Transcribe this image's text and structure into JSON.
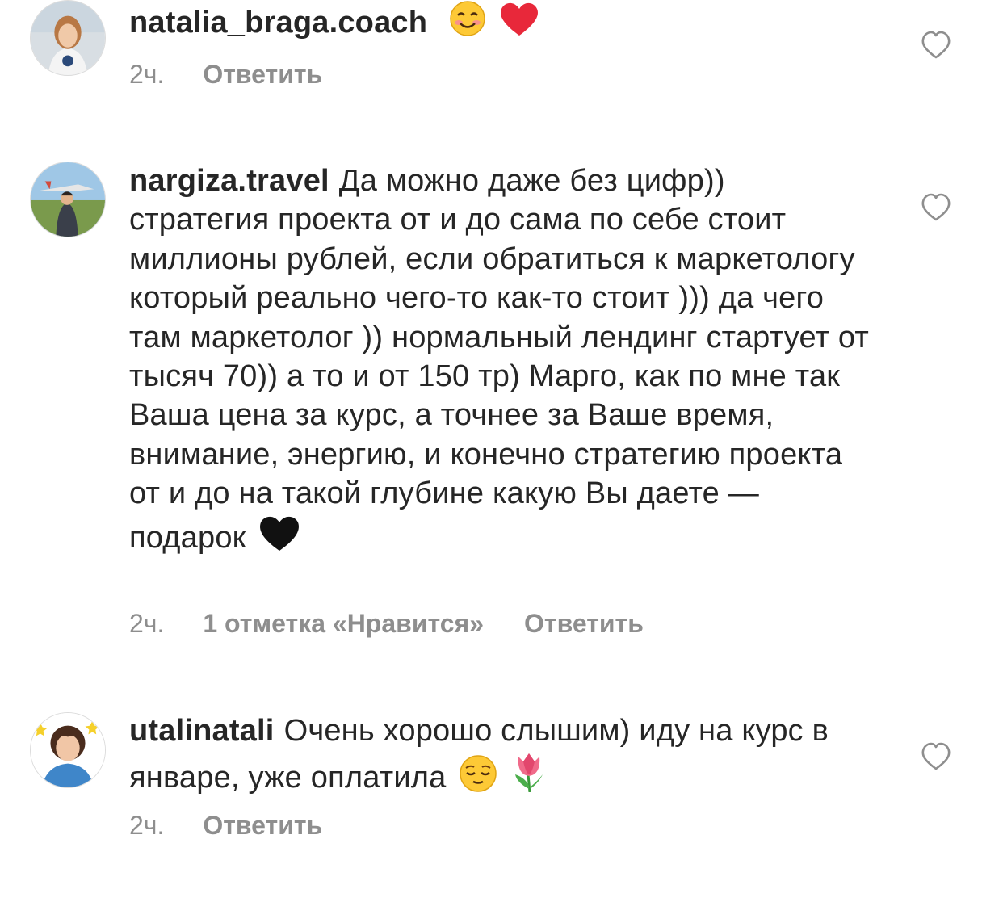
{
  "comments": [
    {
      "username": "natalia_braga.coach",
      "text": "",
      "emojis": [
        "smiling-face-emoji",
        "red-heart-emoji"
      ],
      "time": "2ч.",
      "likes": "",
      "reply_label": "Ответить"
    },
    {
      "username": "nargiza.travel",
      "text": "Да можно даже без цифр)) стратегия проекта от и до сама по себе стоит миллионы рублей, если обратиться к маркетологу который реально чего-то как-то стоит ))) да чего там маркетолог )) нормальный лендинг стартует от тысяч 70)) а то и от 150 тр) Марго,  как по мне так Ваша цена за курс, а точнее за Ваше время, внимание, энергию, и конечно стратегию проекта от и до на такой глубине какую Вы даете — подарок",
      "emojis": [
        "black-heart-emoji"
      ],
      "time": "2ч.",
      "likes": "1 отметка «Нравится»",
      "reply_label": "Ответить"
    },
    {
      "username": "utalinatali",
      "text": "Очень хорошо слышим) иду на курс в январе, уже оплатила",
      "emojis": [
        "relieved-face-emoji",
        "tulip-emoji"
      ],
      "time": "2ч.",
      "likes": "",
      "reply_label": "Ответить"
    }
  ],
  "colors": {
    "text": "#262626",
    "meta": "#8e8e8e",
    "heart_outline": "#8e8e8e"
  }
}
